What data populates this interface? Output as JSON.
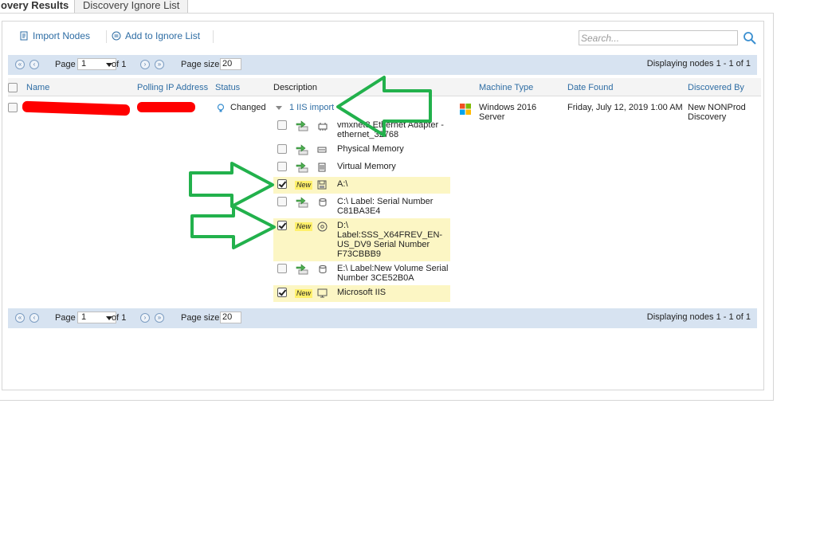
{
  "tabs": [
    {
      "label": "overy Results",
      "active": true
    },
    {
      "label": "Discovery Ignore List",
      "active": false
    }
  ],
  "toolbar": {
    "import_nodes": "Import Nodes",
    "add_to_ignore": "Add to Ignore List",
    "search_placeholder": "Search..."
  },
  "pager": {
    "page_label": "Page",
    "page_value": "1",
    "of_label": "of 1",
    "page_size_label": "Page size",
    "page_size_value": "20",
    "displaying": "Displaying nodes 1 - 1 of 1"
  },
  "columns": {
    "name": "Name",
    "polling_ip": "Polling IP Address",
    "status": "Status",
    "description": "Description",
    "machine_type": "Machine Type",
    "date_found": "Date Found",
    "discovered_by": "Discovered By"
  },
  "row": {
    "status": "Changed",
    "description_toggle": "1 IIS import",
    "machine_type": "Windows 2016 Server",
    "date_found": "Friday, July 12, 2019 1:00 AM",
    "discovered_by": "New NONProd Discovery"
  },
  "sub_items": [
    {
      "label": "vmxnet3 Ethernet Adapter - ethernet_32768",
      "checked": false,
      "new": false,
      "icon": "network-adapter-icon"
    },
    {
      "label": "Physical Memory",
      "checked": false,
      "new": false,
      "icon": "memory-icon"
    },
    {
      "label": "Virtual Memory",
      "checked": false,
      "new": false,
      "icon": "virtual-memory-icon"
    },
    {
      "label": "A:\\",
      "checked": true,
      "new": true,
      "icon": "floppy-icon"
    },
    {
      "label": "C:\\ Label: Serial Number C81BA3E4",
      "checked": false,
      "new": false,
      "icon": "disk-icon"
    },
    {
      "label": "D:\\ Label:SSS_X64FREV_EN-US_DV9 Serial Number F73CBBB9",
      "checked": true,
      "new": true,
      "icon": "cd-icon"
    },
    {
      "label": "E:\\ Label:New Volume Serial Number 3CE52B0A",
      "checked": false,
      "new": false,
      "icon": "disk-icon"
    },
    {
      "label": "Microsoft IIS",
      "checked": true,
      "new": true,
      "icon": "application-icon"
    }
  ],
  "new_badge": "New",
  "colors": {
    "link": "#2e6da4",
    "pager_bg": "#d7e3f1",
    "highlight": "#fcf6c4",
    "annotation_arrow": "#22b14c",
    "redaction": "#ff0000"
  }
}
